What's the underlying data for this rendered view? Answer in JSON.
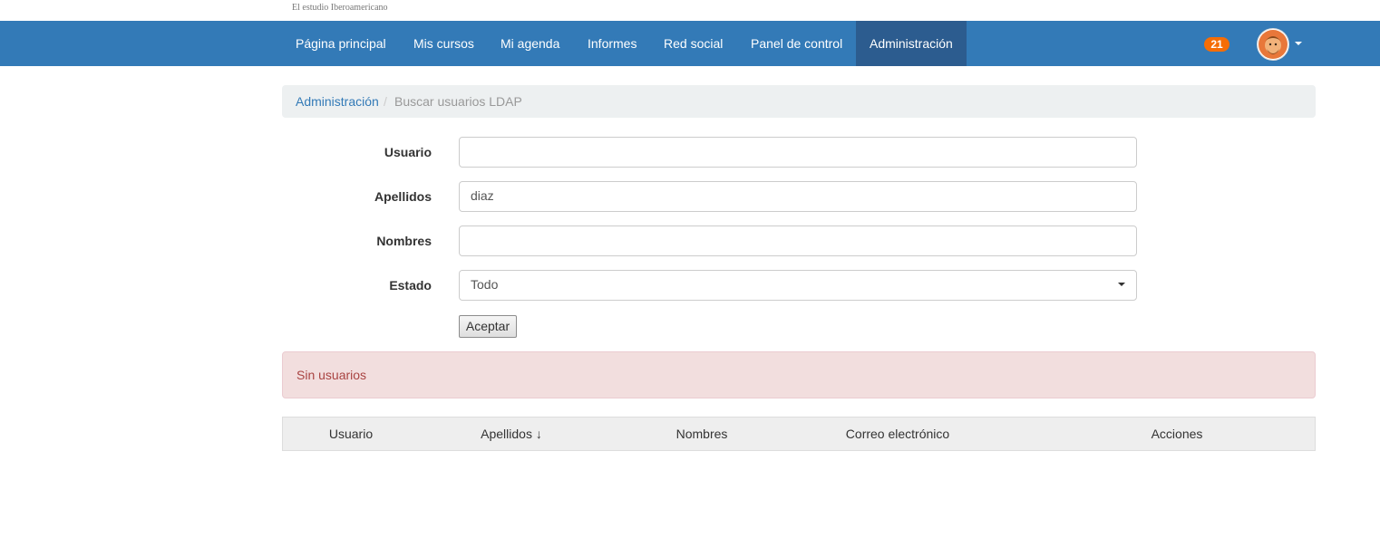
{
  "brand": {
    "text": "El estudio Iberoamericano"
  },
  "nav": {
    "items": [
      {
        "label": "Página principal"
      },
      {
        "label": "Mis cursos"
      },
      {
        "label": "Mi agenda"
      },
      {
        "label": "Informes"
      },
      {
        "label": "Red social"
      },
      {
        "label": "Panel de control"
      },
      {
        "label": "Administración",
        "active": true
      }
    ],
    "notifications_count": "21"
  },
  "breadcrumb": {
    "parent": "Administración",
    "separator": "/",
    "current": "Buscar usuarios LDAP"
  },
  "form": {
    "usuario": {
      "label": "Usuario",
      "value": ""
    },
    "apellidos": {
      "label": "Apellidos",
      "value": "diaz"
    },
    "nombres": {
      "label": "Nombres",
      "value": ""
    },
    "estado": {
      "label": "Estado",
      "selected": "Todo"
    },
    "submit_label": "Aceptar"
  },
  "alert": {
    "message": "Sin usuarios"
  },
  "table": {
    "columns": [
      "Usuario",
      "Apellidos ↓",
      "Nombres",
      "Correo electrónico",
      "Acciones"
    ]
  },
  "colors": {
    "navbar": "#337ab7",
    "nav_active": "#2c5c8f",
    "badge": "#f56d06",
    "alert_bg": "#f2dede",
    "alert_text": "#a94442"
  }
}
